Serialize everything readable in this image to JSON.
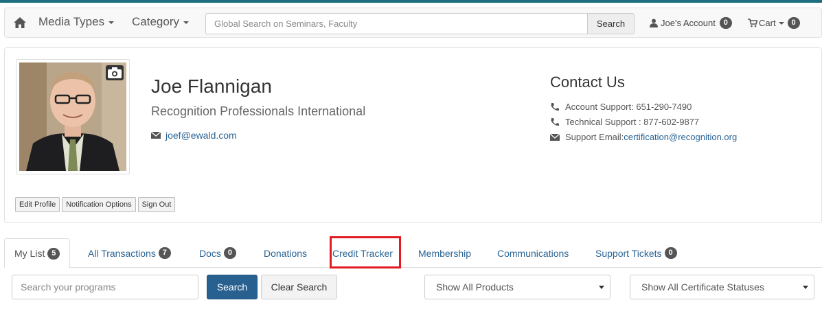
{
  "nav": {
    "media_types": "Media Types",
    "category": "Category",
    "search_placeholder": "Global Search on Seminars, Faculty",
    "search_button": "Search",
    "account_label": "Joe's Account",
    "account_badge": "0",
    "cart_label": "Cart",
    "cart_badge": "0"
  },
  "profile": {
    "name": "Joe Flannigan",
    "organization": "Recognition Professionals International",
    "email": "joef@ewald.com",
    "buttons": {
      "edit": "Edit Profile",
      "notifications": "Notification Options",
      "signout": "Sign Out"
    }
  },
  "contact": {
    "heading": "Contact Us",
    "account_support": "Account Support: 651-290-7490",
    "technical_support": "Technical Support : 877-602-9877",
    "support_email_label": "Support Email: ",
    "support_email": "certification@recognition.org"
  },
  "tabs": [
    {
      "label": "My List",
      "badge": "5"
    },
    {
      "label": "All Transactions",
      "badge": "7"
    },
    {
      "label": "Docs",
      "badge": "0"
    },
    {
      "label": "Donations",
      "badge": ""
    },
    {
      "label": "Credit Tracker",
      "badge": ""
    },
    {
      "label": "Membership",
      "badge": ""
    },
    {
      "label": "Communications",
      "badge": ""
    },
    {
      "label": "Support Tickets",
      "badge": "0"
    }
  ],
  "filters": {
    "search_placeholder": "Search your programs",
    "search_button": "Search",
    "clear_button": "Clear Search",
    "products_select": "Show All Products",
    "status_select": "Show All Certificate Statuses"
  },
  "colors": {
    "accent_bar": "#1f6e80",
    "link": "#2a6496",
    "highlight": "#e01a22",
    "primary_button": "#286090"
  }
}
